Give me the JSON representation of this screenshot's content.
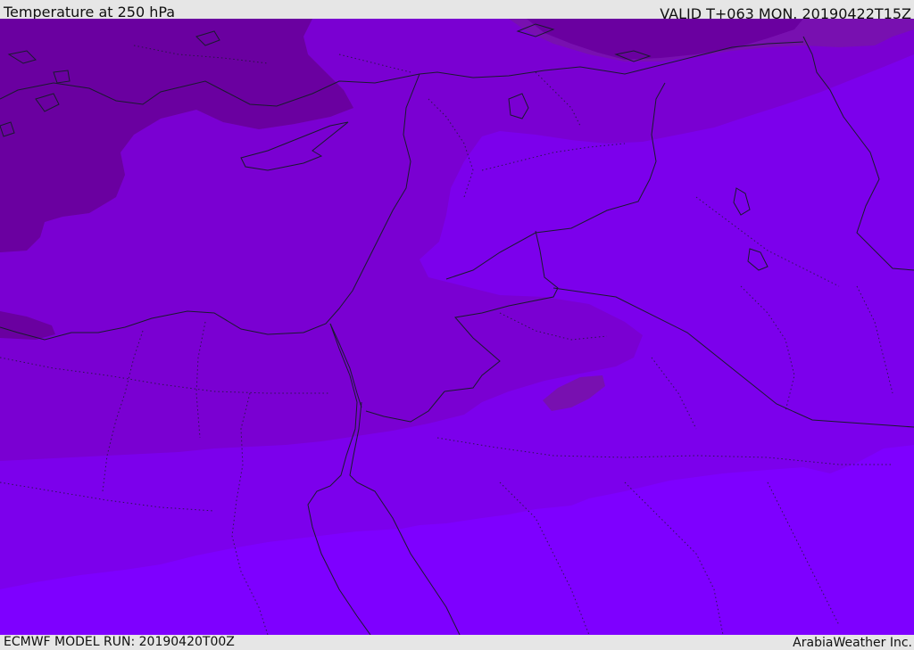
{
  "header": {
    "title": "Temperature at 250 hPa",
    "valid": "VALID T+063 MON. 20190422T15Z"
  },
  "footer": {
    "model_run": "ECMWF MODEL RUN: 20190420T00Z",
    "credit": "ArabiaWeather Inc."
  },
  "colors": {
    "band_coldest": "#6a00a0",
    "band_cold": "#7810b0",
    "band_mid": "#7a00d2",
    "band_warm": "#7c00ec",
    "band_warmest": "#7e00ff",
    "coastline": "#1a1a2e",
    "border": "#1a1a2e",
    "frame": "#e6e6e6"
  }
}
